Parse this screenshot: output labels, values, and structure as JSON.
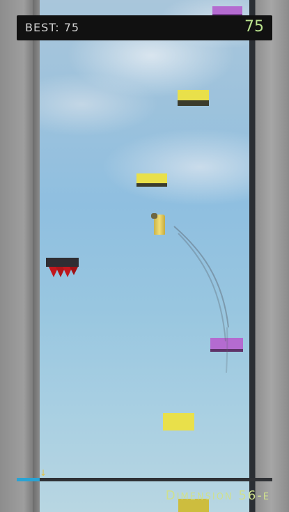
{
  "hud": {
    "best_label": "BEST: 75",
    "score": "75"
  },
  "level": {
    "name": "Dimension 56-e",
    "progress": 0.09
  },
  "colors": {
    "platform_yellow": "#e9e04a",
    "platform_purple": "#b46bd0",
    "spike_red": "#c2171d",
    "progress": "#2aa3d3",
    "score_text": "#b8e08c"
  },
  "icons": {
    "progress_marker": "down-arrow-icon"
  }
}
